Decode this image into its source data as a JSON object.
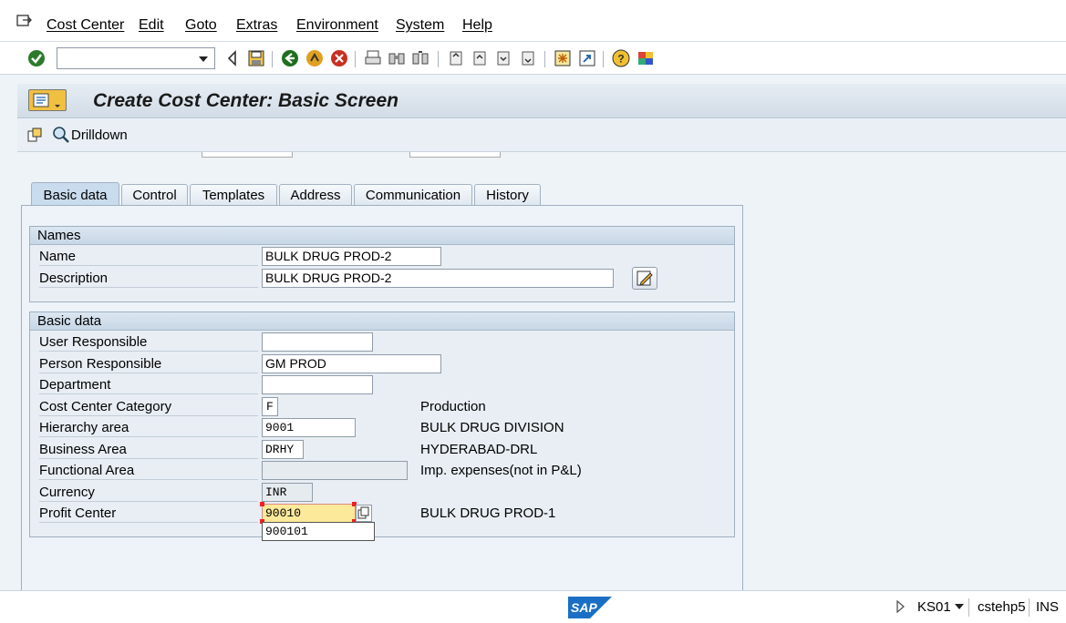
{
  "menu": {
    "items": [
      "Cost Center",
      "Edit",
      "Goto",
      "Extras",
      "Environment",
      "System",
      "Help"
    ]
  },
  "toolbar": {
    "command_value": ""
  },
  "title": "Create Cost Center: Basic Screen",
  "app_toolbar": {
    "drilldown_label": "Drilldown"
  },
  "tabs": [
    "Basic data",
    "Control",
    "Templates",
    "Address",
    "Communication",
    "History"
  ],
  "names_group": {
    "header": "Names",
    "name_label": "Name",
    "name_value": "BULK DRUG PROD-2",
    "description_label": "Description",
    "description_value": "BULK DRUG PROD-2"
  },
  "basic_group": {
    "header": "Basic data",
    "user_responsible_label": "User Responsible",
    "user_responsible_value": "",
    "person_responsible_label": "Person Responsible",
    "person_responsible_value": "GM PROD",
    "department_label": "Department",
    "department_value": "",
    "category_label": "Cost Center Category",
    "category_value": "F",
    "category_desc": "Production",
    "hierarchy_label": "Hierarchy area",
    "hierarchy_value": "9001",
    "hierarchy_desc": "BULK DRUG DIVISION",
    "business_area_label": "Business Area",
    "business_area_value": "DRHY",
    "business_area_desc": "HYDERABAD-DRL",
    "functional_area_label": "Functional Area",
    "functional_area_value": "",
    "functional_area_desc": "Imp. expenses(not in P&L)",
    "currency_label": "Currency",
    "currency_value": "INR",
    "profit_center_label": "Profit Center",
    "profit_center_value": "90010",
    "profit_center_desc": "BULK DRUG PROD-1",
    "profit_center_suggestion": "900101"
  },
  "status": {
    "transaction": "KS01",
    "server": "cstehp5",
    "mode": "INS"
  },
  "colors": {
    "title_bg": "#d2dce6",
    "focus_field": "#fde99a",
    "sap_blue": "#1a6fc4"
  }
}
